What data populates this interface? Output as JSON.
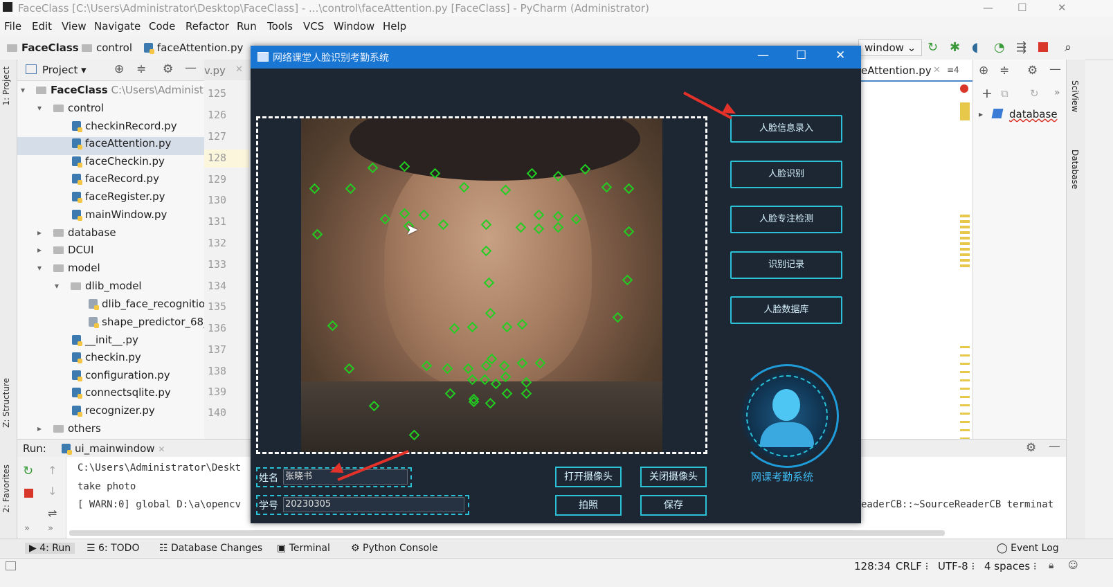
{
  "ide": {
    "title": "FaceClass [C:\\Users\\Administrator\\Desktop\\FaceClass] - ...\\control\\faceAttention.py [FaceClass] - PyCharm (Administrator)",
    "menu": [
      "File",
      "Edit",
      "View",
      "Navigate",
      "Code",
      "Refactor",
      "Run",
      "Tools",
      "VCS",
      "Window",
      "Help"
    ],
    "breadcrumbs": [
      "FaceClass",
      "control",
      "faceAttention.py"
    ],
    "run_config": "window",
    "project_tab": "Project",
    "editor_tabs": {
      "left": "v.py",
      "right": "eAttention.py"
    },
    "tree": [
      {
        "label": "FaceClass",
        "extra": "C:\\Users\\Administrat",
        "type": "root"
      },
      {
        "label": "control",
        "type": "folder"
      },
      {
        "label": "checkinRecord.py",
        "type": "file"
      },
      {
        "label": "faceAttention.py",
        "type": "file",
        "selected": true
      },
      {
        "label": "faceCheckin.py",
        "type": "file"
      },
      {
        "label": "faceRecord.py",
        "type": "file"
      },
      {
        "label": "faceRegister.py",
        "type": "file"
      },
      {
        "label": "mainWindow.py",
        "type": "file"
      },
      {
        "label": "database",
        "type": "folder"
      },
      {
        "label": "DCUI",
        "type": "folder"
      },
      {
        "label": "model",
        "type": "folder"
      },
      {
        "label": "dlib_model",
        "type": "folder"
      },
      {
        "label": "dlib_face_recognitior",
        "type": "file"
      },
      {
        "label": "shape_predictor_68_f",
        "type": "file"
      },
      {
        "label": "__init__.py",
        "type": "file"
      },
      {
        "label": "checkin.py",
        "type": "file"
      },
      {
        "label": "configuration.py",
        "type": "file"
      },
      {
        "label": "connectsqlite.py",
        "type": "file"
      },
      {
        "label": "recognizer.py",
        "type": "file"
      },
      {
        "label": "others",
        "type": "folder"
      }
    ],
    "line_numbers": [
      "125",
      "126",
      "127",
      "128",
      "129",
      "130",
      "131",
      "132",
      "133",
      "134",
      "135",
      "136",
      "137",
      "138",
      "139",
      "140"
    ],
    "right_panel_item": "database",
    "left_tool_tabs": [
      "1: Project",
      "Z: Structure",
      "2: Favorites"
    ],
    "right_tool_tabs": [
      "SciView",
      "Database"
    ],
    "run": {
      "label": "Run:",
      "config_tab": "ui_mainwindow",
      "lines": [
        "C:\\Users\\Administrator\\Deskt",
        "take photo",
        "[ WARN:0] global D:\\a\\opencv"
      ],
      "right_text": "eaderCB::~SourceReaderCB terminat"
    },
    "bottom_tabs": [
      "4: Run",
      "6: TODO",
      "Database Changes",
      "Terminal",
      "Python Console"
    ],
    "event_log": "Event Log",
    "status": {
      "position": "128:34",
      "line_sep": "CRLF",
      "encoding": "UTF-8",
      "indent": "4 spaces"
    }
  },
  "app": {
    "title": "网络课堂人脸识别考勤系统",
    "side_buttons": [
      "人脸信息录入",
      "人脸识别",
      "人脸专注检测",
      "识别记录",
      "人脸数据库"
    ],
    "name_label": "姓名",
    "name_value": "张晓书",
    "id_label": "学号",
    "id_value": "20230305",
    "buttons": {
      "open_camera": "打开摄像头",
      "close_camera": "关闭摄像头",
      "capture": "拍照",
      "save": "保存"
    },
    "logo_text": "网课考勤系统",
    "landmark_color": "#20d020",
    "accent_color": "#2bc1d6"
  }
}
